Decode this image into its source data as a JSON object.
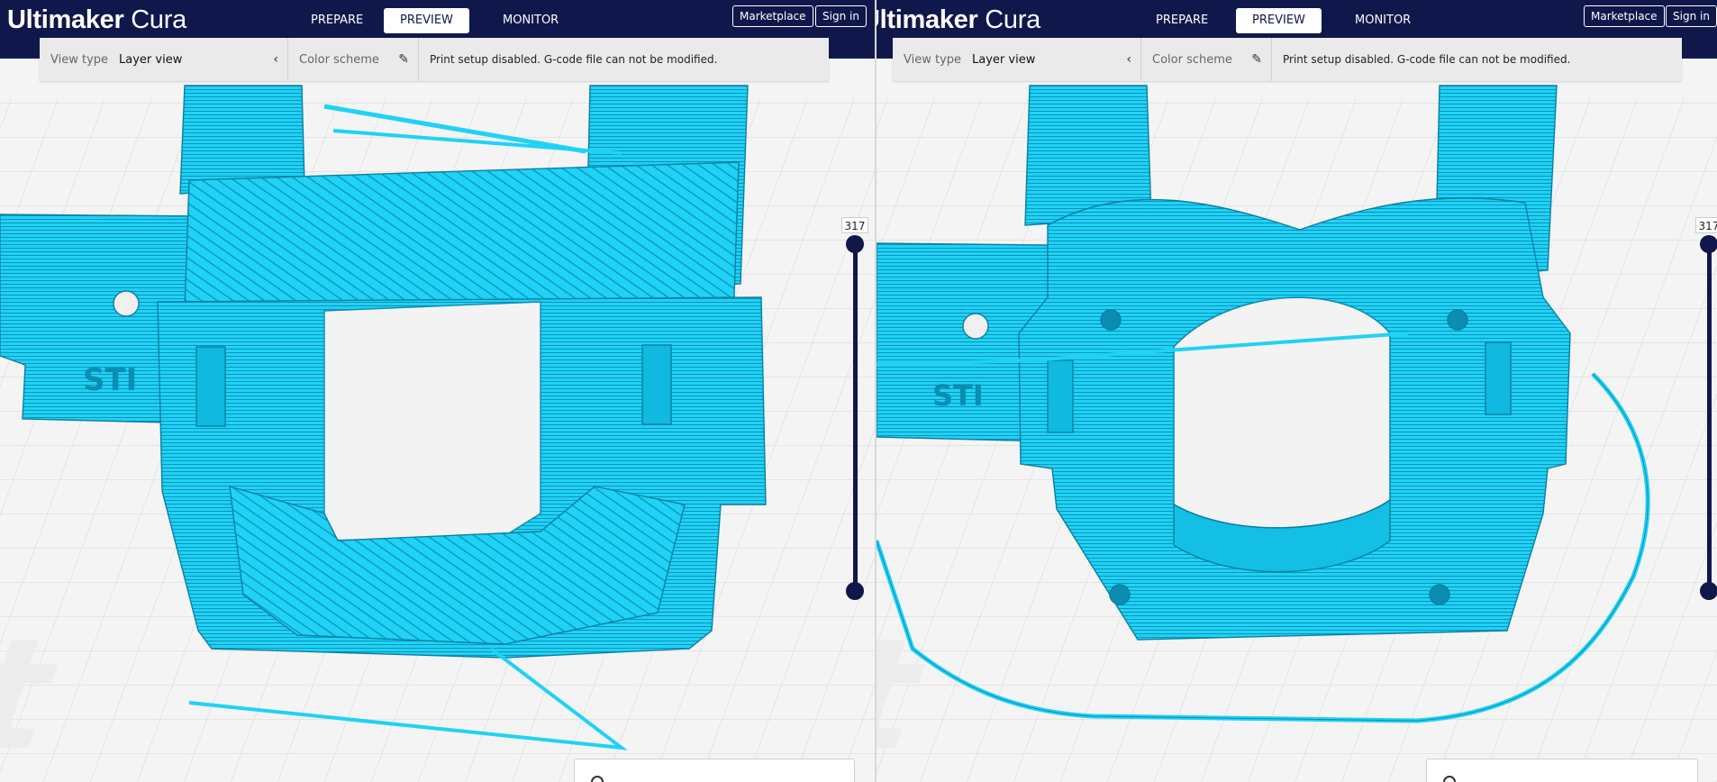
{
  "app": {
    "logo_bold": "Ultimaker",
    "logo_light": " Cura"
  },
  "stages": [
    "PREPARE",
    "PREVIEW",
    "MONITOR"
  ],
  "active_stage": "PREVIEW",
  "header": {
    "marketplace_label": "Marketplace",
    "signin_label": "Sign in"
  },
  "view_bar": {
    "view_type_label": "View type",
    "view_type_value": "Layer view",
    "color_scheme_label": "Color scheme",
    "message": "Print setup disabled. G-code file can not be modified."
  },
  "layer_slider": {
    "value": "317"
  },
  "colors": {
    "header_bg": "#10174a",
    "model_cyan": "#1fd2f6",
    "model_edge": "#0a8db0",
    "build_plate": "#f4f4f4",
    "slider": "#10174a"
  },
  "icons": {
    "collapse": "chevron-left-icon",
    "edit": "pencil-icon",
    "info": "info-icon"
  }
}
